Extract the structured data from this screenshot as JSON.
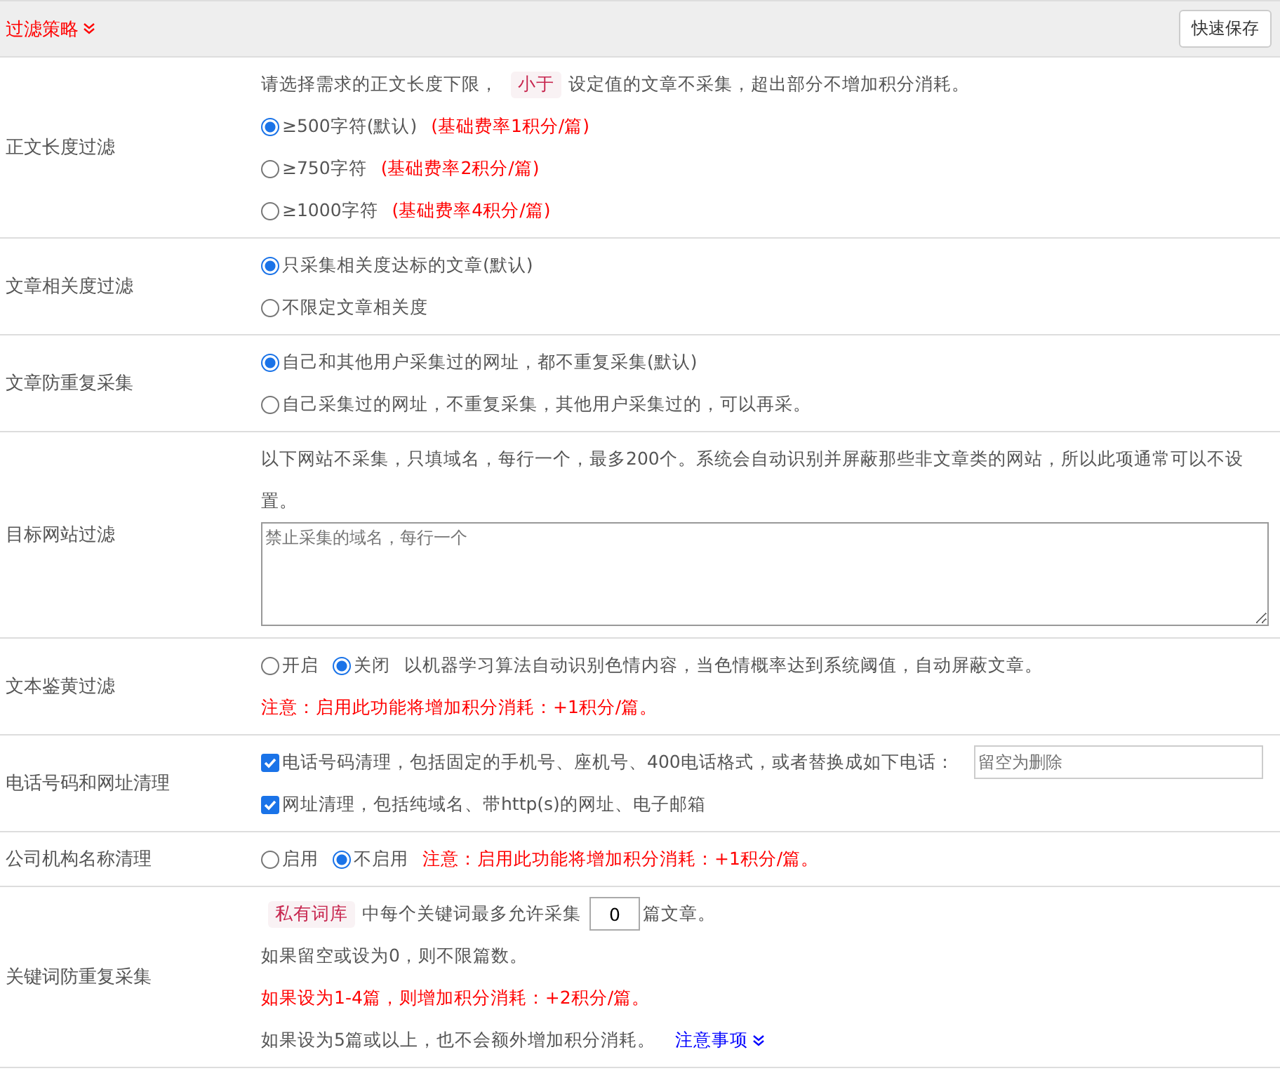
{
  "header": {
    "title": "过滤策略",
    "save_button": "快速保存"
  },
  "sections": [
    {
      "label": "正文长度过滤",
      "lines": [
        [
          {
            "kind": "text",
            "text": "请选择需求的正文长度下限，",
            "warn": false
          },
          {
            "kind": "tag",
            "text": "小于"
          },
          {
            "kind": "text",
            "text": "设定值的文章不采集，超出部分不增加积分消耗。",
            "warn": false
          }
        ],
        [
          {
            "kind": "radio",
            "text": "≥500字符(默认)",
            "selected": true
          },
          {
            "kind": "text",
            "text": "(基础费率1积分/篇)",
            "warn": true
          }
        ],
        [
          {
            "kind": "radio",
            "text": "≥750字符",
            "selected": false
          },
          {
            "kind": "text",
            "text": "(基础费率2积分/篇)",
            "warn": true
          }
        ],
        [
          {
            "kind": "radio",
            "text": "≥1000字符",
            "selected": false
          },
          {
            "kind": "text",
            "text": "(基础费率4积分/篇)",
            "warn": true
          }
        ]
      ]
    },
    {
      "label": "文章相关度过滤",
      "lines": [
        [
          {
            "kind": "radio",
            "text": "只采集相关度达标的文章(默认)",
            "selected": true
          }
        ],
        [
          {
            "kind": "radio",
            "text": "不限定文章相关度",
            "selected": false
          }
        ]
      ]
    },
    {
      "label": "文章防重复采集",
      "lines": [
        [
          {
            "kind": "radio",
            "text": "自己和其他用户采集过的网址，都不重复采集(默认)",
            "selected": true
          }
        ],
        [
          {
            "kind": "radio",
            "text": "自己采集过的网址，不重复采集，其他用户采集过的，可以再采。",
            "selected": false
          }
        ]
      ]
    },
    {
      "label": "目标网站过滤",
      "lines": [
        [
          {
            "kind": "text",
            "text": "以下网站不采集，只填域名，每行一个，最多200个。系统会自动识别并屏蔽那些非文章类的网站，所以此项通常可以不设置。",
            "warn": false
          }
        ],
        [
          {
            "kind": "textarea",
            "placeholder": "禁止采集的域名，每行一个"
          }
        ]
      ]
    },
    {
      "label": "文本鉴黄过滤",
      "lines": [
        [
          {
            "kind": "radio",
            "text": "开启",
            "selected": false
          },
          {
            "kind": "radio",
            "text": "关闭",
            "selected": true
          },
          {
            "kind": "text",
            "text": "以机器学习算法自动识别色情内容，当色情概率达到系统阈值，自动屏蔽文章。",
            "warn": false
          }
        ],
        [
          {
            "kind": "text",
            "text": "注意：启用此功能将增加积分消耗：+1积分/篇。",
            "warn": true
          }
        ]
      ]
    },
    {
      "label": "电话号码和网址清理",
      "lines": [
        [
          {
            "kind": "checkbox",
            "text": "电话号码清理，包括固定的手机号、座机号、400电话格式，或者替换成如下电话：",
            "checked": true
          },
          {
            "kind": "input",
            "placeholder": "留空为删除"
          }
        ],
        [
          {
            "kind": "checkbox",
            "text": "网址清理，包括纯域名、带http(s)的网址、电子邮箱",
            "checked": true
          }
        ]
      ]
    },
    {
      "label": "公司机构名称清理",
      "lines": [
        [
          {
            "kind": "radio",
            "text": "启用",
            "selected": false
          },
          {
            "kind": "radio",
            "text": "不启用",
            "selected": true
          },
          {
            "kind": "text",
            "text": "注意：启用此功能将增加积分消耗：+1积分/篇。",
            "warn": true
          }
        ]
      ]
    },
    {
      "label": "关键词防重复采集",
      "lines": [
        [
          {
            "kind": "tag",
            "text": "私有词库"
          },
          {
            "kind": "text",
            "text": "中每个关键词最多允许采集",
            "warn": false
          },
          {
            "kind": "number",
            "value": "0"
          },
          {
            "kind": "text",
            "text": "篇文章。",
            "warn": false
          }
        ],
        [
          {
            "kind": "text",
            "text": "如果留空或设为0，则不限篇数。",
            "warn": false
          }
        ],
        [
          {
            "kind": "text",
            "text": "如果设为1-4篇，则增加积分消耗：+2积分/篇。",
            "warn": true
          }
        ],
        [
          {
            "kind": "text",
            "text": "如果设为5篇或以上，也不会额外增加积分消耗。",
            "warn": false
          },
          {
            "kind": "link",
            "text": "注意事项"
          }
        ]
      ]
    }
  ]
}
